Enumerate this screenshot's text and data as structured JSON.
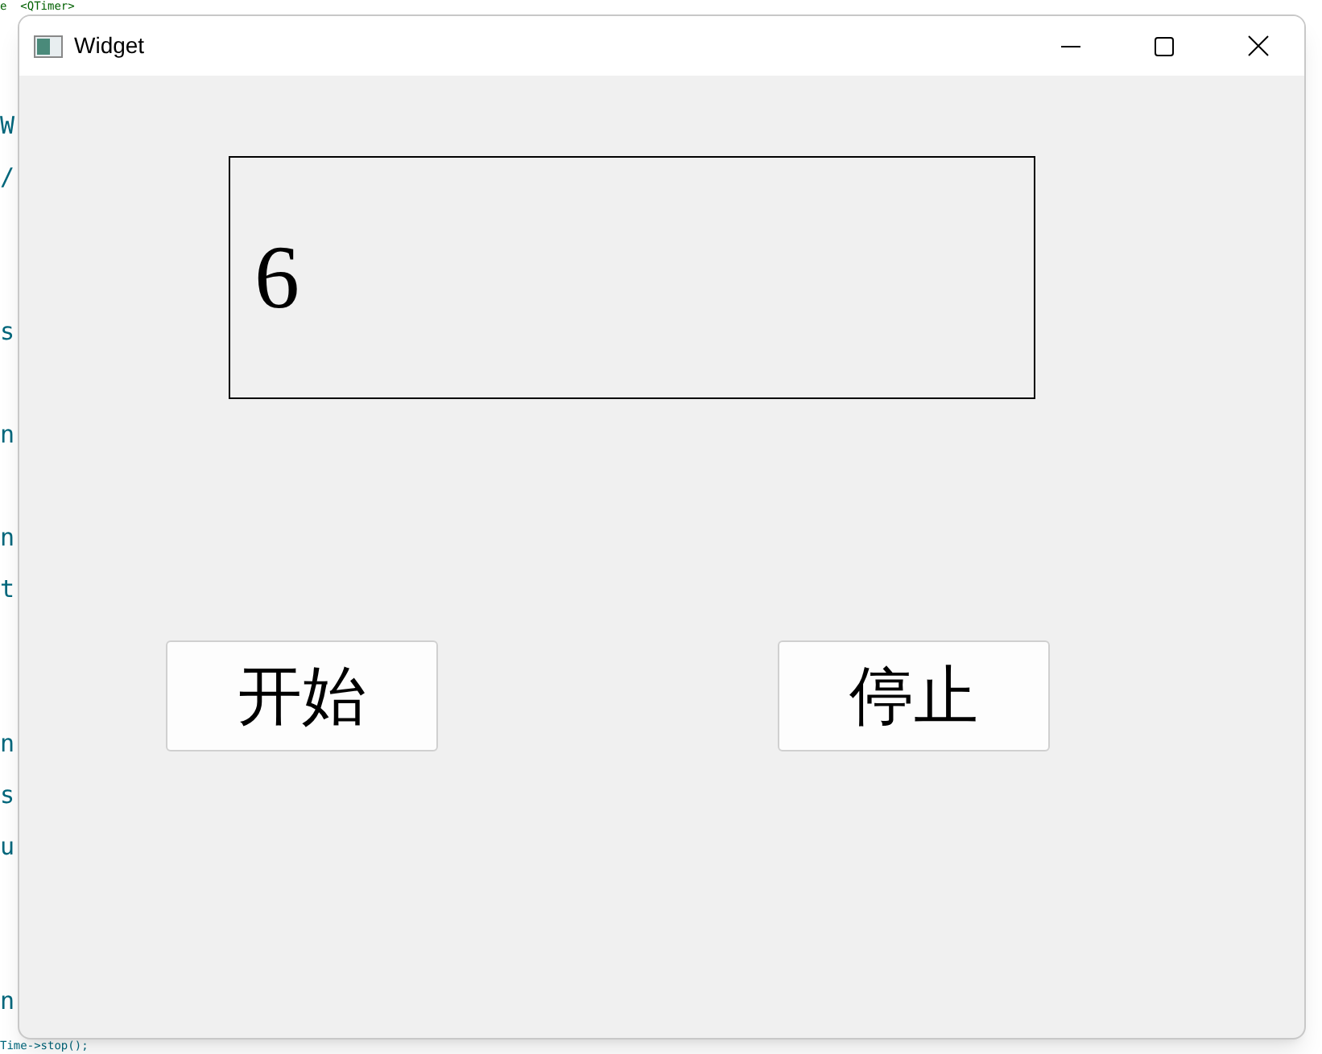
{
  "editor": {
    "top_line": "e  <QTimer>",
    "lines": [
      {
        "kind": "blank"
      },
      {
        "kind": "code",
        "text": "W"
      },
      {
        "kind": "code",
        "text": "/"
      },
      {
        "kind": "blank"
      },
      {
        "kind": "blank"
      },
      {
        "kind": "code",
        "text": "s"
      },
      {
        "kind": "blank"
      },
      {
        "kind": "code",
        "text": "n"
      },
      {
        "kind": "blank"
      },
      {
        "kind": "code",
        "text": "n"
      },
      {
        "kind": "code",
        "text": "t"
      },
      {
        "kind": "blank"
      },
      {
        "kind": "blank"
      },
      {
        "kind": "code",
        "text": "n"
      },
      {
        "kind": "code",
        "text": "s"
      },
      {
        "kind": "code",
        "text": "u"
      },
      {
        "kind": "blank"
      },
      {
        "kind": "blank"
      },
      {
        "kind": "code",
        "text": "n"
      }
    ],
    "bottom_line": "Time->stop();"
  },
  "window": {
    "title": "Widget"
  },
  "display": {
    "value": "6"
  },
  "buttons": [
    {
      "label": "开始"
    },
    {
      "label": "停止"
    }
  ]
}
